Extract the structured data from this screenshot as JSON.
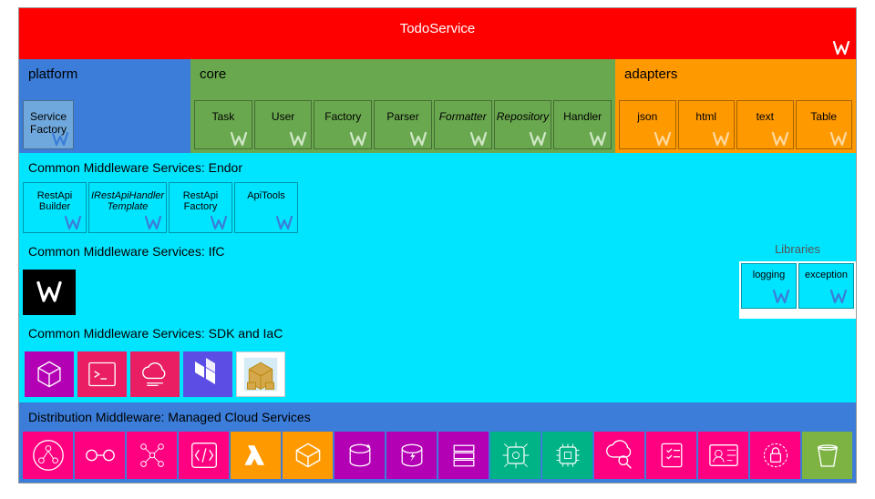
{
  "header": {
    "title": "TodoService"
  },
  "sections": {
    "platform": {
      "label": "platform",
      "tiles": [
        "Service\nFactory"
      ]
    },
    "core": {
      "label": "core",
      "tiles": [
        "Task",
        "User",
        "Factory",
        "Parser",
        "Formatter",
        "Repository",
        "Handler"
      ]
    },
    "adapters": {
      "label": "adapters",
      "tiles": [
        "json",
        "html",
        "text",
        "Table"
      ]
    }
  },
  "endor": {
    "label": "Common Middleware Services: Endor",
    "tiles": [
      "RestApi\nBuilder",
      "IRestApiHandler\nTemplate",
      "RestApi\nFactory",
      "ApiTools"
    ]
  },
  "ifc": {
    "label": "Common Middleware Services: IfC",
    "libraries_label": "Libraries",
    "libs": [
      "logging",
      "exception"
    ]
  },
  "sdk": {
    "label": "Common Middleware Services: SDK and IaC",
    "icons": [
      "cube",
      "terminal",
      "cloud-code",
      "terraform",
      "package"
    ]
  },
  "distribution": {
    "label": "Distribution Middleware: Managed Cloud Services",
    "icons": [
      {
        "name": "gateway",
        "bg": "hotpink"
      },
      {
        "name": "events",
        "bg": "hotpink"
      },
      {
        "name": "workflow",
        "bg": "hotpink"
      },
      {
        "name": "functions",
        "bg": "hotpink"
      },
      {
        "name": "lambda",
        "bg": "orange"
      },
      {
        "name": "container",
        "bg": "orange"
      },
      {
        "name": "database-sparkle",
        "bg": "purple"
      },
      {
        "name": "database-bolt",
        "bg": "purple"
      },
      {
        "name": "rack",
        "bg": "purple"
      },
      {
        "name": "chip",
        "bg": "teal"
      },
      {
        "name": "chip-alt",
        "bg": "teal"
      },
      {
        "name": "cloud-search",
        "bg": "hotpink"
      },
      {
        "name": "checklist",
        "bg": "hotpink"
      },
      {
        "name": "security-id",
        "bg": "hotpink"
      },
      {
        "name": "security-lock",
        "bg": "hotpink"
      },
      {
        "name": "bucket",
        "bg": "green"
      }
    ]
  }
}
